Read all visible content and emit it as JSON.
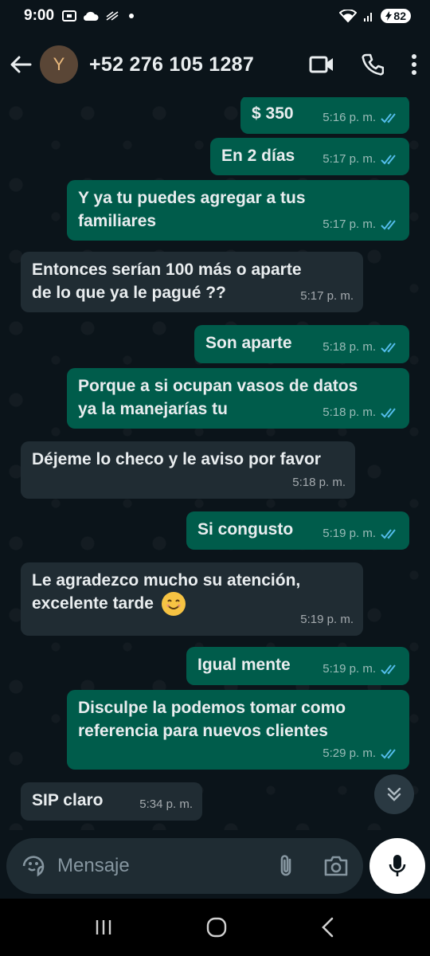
{
  "status_bar": {
    "time": "9:00",
    "battery": "82"
  },
  "header": {
    "avatar_letter": "Y",
    "contact": "+52 276 105 1287",
    "icons": [
      "back-arrow-icon",
      "video-call-icon",
      "phone-icon",
      "more-vert-icon"
    ]
  },
  "messages": [
    {
      "dir": "out",
      "text": "$ 350",
      "time": "5:16 p. m.",
      "read": true
    },
    {
      "dir": "out",
      "text": "En 2 días",
      "time": "5:17 p. m.",
      "read": true
    },
    {
      "dir": "out",
      "text": "Y ya tu puedes agregar a tus\nfamiliares",
      "time": "5:17 p. m.",
      "read": true
    },
    {
      "dir": "in",
      "text": "Entonces serían 100 más o aparte\nde lo que ya le pagué ??",
      "time": "5:17 p. m."
    },
    {
      "dir": "out",
      "text": "Son aparte",
      "time": "5:18 p. m.",
      "read": true
    },
    {
      "dir": "out",
      "text": "Porque a si ocupan vasos de datos\nya la manejarías tu",
      "time": "5:18 p. m.",
      "read": true
    },
    {
      "dir": "in",
      "text": "Déjeme lo checo y le aviso por favor",
      "time": "5:18 p. m."
    },
    {
      "dir": "out",
      "text": "Si congusto",
      "time": "5:19 p. m.",
      "read": true
    },
    {
      "dir": "in",
      "text": "Le agradezco mucho su atención,\nexcelente tarde",
      "time": "5:19 p. m.",
      "emoji": "smiling-face-emoji"
    },
    {
      "dir": "out",
      "text": "Igual mente",
      "time": "5:19 p. m.",
      "read": true
    },
    {
      "dir": "out",
      "text": "Disculpe la podemos tomar como\nreferencia para nuevos clientes",
      "time": "5:29 p. m.",
      "read": true
    },
    {
      "dir": "in",
      "text": "SIP claro",
      "time": "5:34 p. m."
    }
  ],
  "input": {
    "placeholder": "Mensaje",
    "icons": [
      "sticker-icon",
      "attach-icon",
      "camera-icon",
      "mic-icon"
    ]
  },
  "colors": {
    "background": "#0b141a",
    "outgoing_bubble": "#005c4b",
    "incoming_bubble": "#202c33",
    "read_ticks": "#53bdeb"
  }
}
